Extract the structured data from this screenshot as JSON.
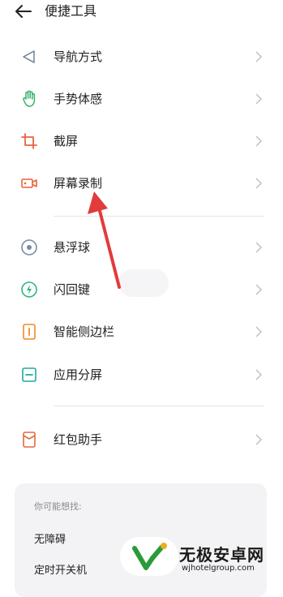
{
  "header": {
    "title": "便捷工具"
  },
  "rows": [
    {
      "label": "导航方式"
    },
    {
      "label": "手势体感"
    },
    {
      "label": "截屏"
    },
    {
      "label": "屏幕录制"
    },
    {
      "label": "悬浮球"
    },
    {
      "label": "闪回键"
    },
    {
      "label": "智能侧边栏"
    },
    {
      "label": "应用分屏"
    },
    {
      "label": "红包助手"
    }
  ],
  "suggest": {
    "heading": "你可能想找:",
    "items": [
      "无障碍",
      "定时开关机"
    ]
  },
  "watermark": {
    "name": "无极安卓网",
    "url": "wjhotelgroup.com"
  },
  "colors": {
    "nav_icon": "#7b8ba3",
    "gesture_icon": "#35b36a",
    "screenshot_icon": "#e8643c",
    "record_icon": "#e8643c",
    "floatball_icon": "#7b8ba3",
    "flashback_icon": "#2fb57e",
    "sidebar_icon": "#f08a24",
    "split_icon": "#20a8a0",
    "redpacket_icon": "#e26a3c",
    "annotation_arrow": "#e23b3b"
  }
}
